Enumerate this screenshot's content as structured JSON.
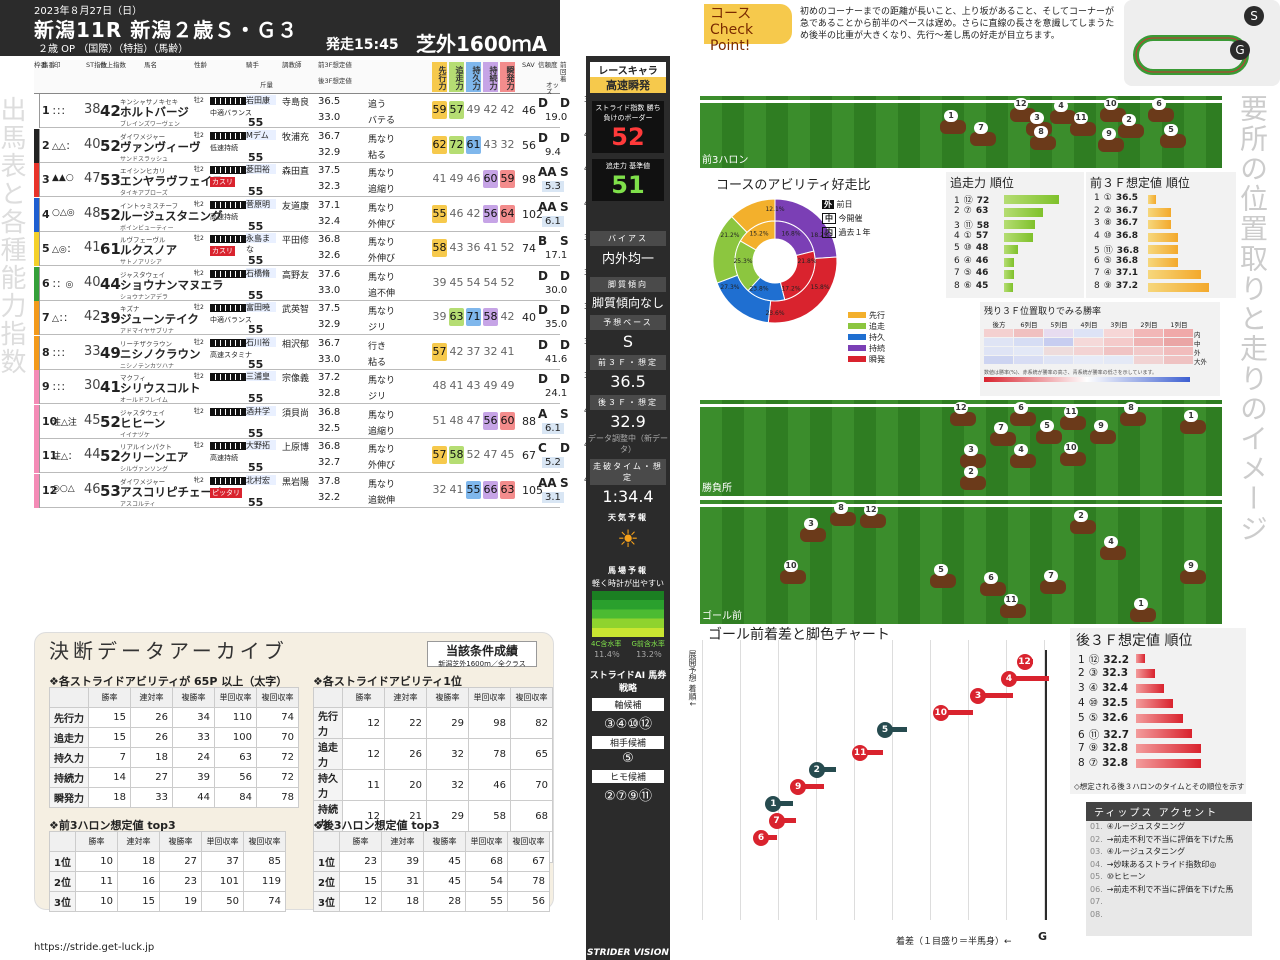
{
  "header": {
    "date": "2023年８月27日（日）",
    "race": "新潟11R  新潟２歳Ｓ・Ｇ３",
    "conditions": "２歳 OP （国際）（特指）（馬齢）",
    "start": "発走15:45",
    "distance": "芝外1600ｍA"
  },
  "course_panel": {
    "title": "コース",
    "subtitle": "Check Point!",
    "text": "初めのコーナーまでの距離が長いこと、上り坂があること、そしてコーナーが急であることから前半のペースは遅め。さらに直線の長さを意識してしまうため後半の比重が大きくなり、先行～差し馬の好走が目立ちます。"
  },
  "side_left": "出馬表と各種能力指数",
  "side_right": "要所の位置取りと走りのイメージ",
  "col_headers": [
    "枠番",
    "馬番",
    "印",
    "ST指数",
    "仕上指数",
    "馬名",
    "性齢",
    "騎手",
    "斤量",
    "調教師",
    "前3F想定値",
    "後3F想定値",
    "先行力",
    "追走力",
    "持久力",
    "持続力",
    "瞬発力",
    "SAV",
    "信頼度",
    "前回着",
    "オッズ"
  ],
  "ability_headers": [
    "先行力",
    "追走力",
    "持久力",
    "持続力",
    "瞬発力"
  ],
  "horses": [
    {
      "frame": "1",
      "num": "1",
      "mark": "：：：",
      "st": "38",
      "sh": "42",
      "sire": "キンシャサノキセキ",
      "name": "ホルトバージ",
      "dam": "ブレインズワーヴェン",
      "sex": "牡2",
      "tag": "中適バランス",
      "wt": "55",
      "jockey": "岩田康",
      "trainer": "寺島良",
      "f3": "36.5",
      "l3": "33.0",
      "c1": "追う",
      "c2": "バテる",
      "ab": [
        "59",
        "57",
        "49",
        "42",
        "42"
      ],
      "sav": "46",
      "g1": "D",
      "g2": "D",
      "odds": "19.0",
      "ax": "38"
    },
    {
      "frame": "2",
      "num": "2",
      "mark": "△△：",
      "st": "40",
      "sh": "52",
      "sire": "ダイワメジャー",
      "name": "ヴァンヴィーヴ",
      "dam": "サンドスラッシュ",
      "sex": "牡2",
      "tag": "低速持続",
      "wt": "55",
      "jockey": "Mデム",
      "trainer": "牧浦充",
      "f3": "36.7",
      "l3": "32.9",
      "c1": "馬なり",
      "c2": "粘る",
      "ab": [
        "62",
        "72",
        "61",
        "43",
        "32"
      ],
      "sav": "56",
      "g1": "D",
      "g2": "D",
      "odds": "9.4",
      "ax": "40"
    },
    {
      "frame": "3",
      "num": "3",
      "mark": "▲▲○",
      "st": "47",
      "sh": "53",
      "sire": "エイシンヒカリ",
      "name": "エンヤラヴフェイス",
      "dam": "タイキアプローズ",
      "sex": "牡2",
      "tag": "カスリ",
      "wt": "55",
      "jockey": "菱田裕",
      "trainer": "森田直",
      "f3": "37.5",
      "l3": "32.3",
      "c1": "馬なり",
      "c2": "追縮り",
      "ab": [
        "41",
        "49",
        "46",
        "60",
        "59"
      ],
      "sav": "98",
      "g1": "AA",
      "g2": "S",
      "odds": "5.3",
      "ax": "43"
    },
    {
      "frame": "4",
      "num": "4",
      "mark": "○△◎",
      "st": "48",
      "sh": "52",
      "sire": "イントゥミスチーフ",
      "name": "ルージュスタニング",
      "dam": "ボインビューティー",
      "sex": "牝2",
      "tag": "高速持続",
      "wt": "55",
      "jockey": "菅原明",
      "trainer": "友道康",
      "f3": "37.1",
      "l3": "32.4",
      "c1": "馬なり",
      "c2": "外伸び",
      "ab": [
        "55",
        "46",
        "42",
        "56",
        "64"
      ],
      "sav": "102",
      "g1": "AA",
      "g2": "S",
      "odds": "6.1",
      "ax": "44"
    },
    {
      "frame": "5",
      "num": "5",
      "mark": "△◎：",
      "st": "41",
      "sh": "61",
      "sire": "ルヴフェーヴル",
      "name": "ルクスノア",
      "dam": "サトノアリシア",
      "sex": "牡2",
      "tag": "カスリ",
      "wt": "55",
      "jockey": "永島まな",
      "trainer": "平田修",
      "f3": "36.8",
      "l3": "32.6",
      "c1": "馬なり",
      "c2": "外伸び",
      "ab": [
        "58",
        "43",
        "36",
        "41",
        "52"
      ],
      "sav": "74",
      "g1": "B",
      "g2": "S",
      "odds": "17.1",
      "ax": "37"
    },
    {
      "frame": "6",
      "num": "6",
      "mark": "：：◎",
      "st": "40",
      "sh": "44",
      "sire": "ジャスタウェイ",
      "name": "ショウナンマヌエラ",
      "dam": "ショウナンアデラ",
      "sex": "牝2",
      "tag": "",
      "wt": "55",
      "jockey": "石橋脩",
      "trainer": "高野友",
      "f3": "37.6",
      "l3": "33.0",
      "c1": "馬なり",
      "c2": "追不伸",
      "ab": [
        "39",
        "45",
        "54",
        "54",
        "52"
      ],
      "sav": "",
      "g1": "D",
      "g2": "D",
      "odds": "30.0",
      "ax": "36"
    },
    {
      "frame": "7",
      "num": "7",
      "mark": "△：：",
      "st": "42",
      "sh": "39",
      "sire": "キズナ",
      "name": "ジューンテイク",
      "dam": "アドマイヤサブリナ",
      "sex": "牡2",
      "tag": "中適バランス",
      "wt": "55",
      "jockey": "富田暁",
      "trainer": "武英智",
      "f3": "37.5",
      "l3": "32.9",
      "c1": "馬なり",
      "c2": "ジリ",
      "ab": [
        "39",
        "63",
        "71",
        "58",
        "42"
      ],
      "sav": "40",
      "g1": "D",
      "g2": "D",
      "odds": "35.0",
      "ax": "37"
    },
    {
      "frame": "7",
      "num": "8",
      "mark": "：：：",
      "st": "33",
      "sh": "49",
      "sire": "リーチザクラウン",
      "name": "ニシノクラウン",
      "dam": "ニシノテンカツハナ",
      "sex": "牡2",
      "tag": "高速スタミナ",
      "wt": "55",
      "jockey": "石川裕",
      "trainer": "相沢郁",
      "f3": "36.7",
      "l3": "33.0",
      "c1": "行き",
      "c2": "粘る",
      "ab": [
        "57",
        "42",
        "37",
        "32",
        "41"
      ],
      "sav": "",
      "g1": "D",
      "g2": "D",
      "odds": "41.6",
      "ax": "35"
    },
    {
      "frame": "8",
      "num": "9",
      "mark": "：：：",
      "st": "30",
      "sh": "41",
      "sire": "マクフィ",
      "name": "シリウスコルト",
      "dam": "オールドフレイム",
      "sex": "牡2",
      "tag": "",
      "wt": "55",
      "jockey": "三浦皇",
      "trainer": "宗像義",
      "f3": "37.2",
      "l3": "32.8",
      "c1": "馬なり",
      "c2": "ジリ",
      "ab": [
        "48",
        "41",
        "43",
        "49",
        "49"
      ],
      "sav": "",
      "g1": "D",
      "g2": "D",
      "odds": "24.1",
      "ax": "39"
    },
    {
      "frame": "8",
      "num": "10",
      "mark": "注△注",
      "st": "45",
      "sh": "52",
      "sire": "ジャスタウェイ",
      "name": "ヒヒーン",
      "dam": "イイナヅケ",
      "sex": "牡2",
      "tag": "",
      "wt": "55",
      "jockey": "酒井学",
      "trainer": "須貝尚",
      "f3": "36.8",
      "l3": "32.5",
      "c1": "馬なり",
      "c2": "追縮り",
      "ab": [
        "51",
        "48",
        "47",
        "56",
        "60"
      ],
      "sav": "88",
      "g1": "A",
      "g2": "S",
      "odds": "6.1",
      "ax": "41"
    },
    {
      "frame": "8",
      "num": "11",
      "mark": "注△：",
      "st": "44",
      "sh": "52",
      "sire": "リアルインパクト",
      "name": "クリーンエア",
      "dam": "シルヴァンソング",
      "sex": "牡2",
      "tag": "高速持続",
      "wt": "55",
      "jockey": "大野拓",
      "trainer": "上原博",
      "f3": "36.8",
      "l3": "32.7",
      "c1": "馬なり",
      "c2": "外伸び",
      "ab": [
        "57",
        "58",
        "52",
        "47",
        "45"
      ],
      "sav": "67",
      "g1": "C",
      "g2": "D",
      "odds": "5.2",
      "ax": "40"
    },
    {
      "frame": "8",
      "num": "12",
      "mark": "◎○△",
      "st": "46",
      "sh": "53",
      "sire": "ダイワメジャー",
      "name": "アスコリピチェーノ",
      "dam": "アスコルティ",
      "sex": "牝2",
      "tag": "ピッタリ",
      "wt": "55",
      "jockey": "北村宏",
      "trainer": "黒岩陽",
      "f3": "37.8",
      "l3": "32.2",
      "c1": "馬なり",
      "c2": "追鋭伸",
      "ab": [
        "32",
        "41",
        "55",
        "66",
        "63"
      ],
      "sav": "105",
      "g1": "AA",
      "g2": "S",
      "odds": "3.1",
      "ax": "42"
    }
  ],
  "center": {
    "race_chara_label": "レースキャラ",
    "race_chara": "高速瞬発",
    "border_label": "ストライド指数 勝ち負けのボーダー",
    "border": "52",
    "chase_label": "追走力 基準値",
    "chase": "51",
    "bias_label": "バイアス",
    "bias": "内外均一",
    "leg_label": "脚質傾向",
    "leg": "脚質傾向なし",
    "pace_label": "予想ペース",
    "pace": "S",
    "f3f_label": "前３Ｆ・想定",
    "f3f": "36.5",
    "l3f_label": "後３Ｆ・想定",
    "l3f": "32.9",
    "adj": "データ調整中（新データ）",
    "time_label": "走破タイム・想定",
    "time": "1:34.4",
    "weather_label": "天気予報",
    "track_label": "馬場予報",
    "track": "軽く時計が出やすい",
    "moist_a": "4C含水率",
    "moist_a_v": "11.4％",
    "moist_b": "G前含水率",
    "moist_b_v": "13.2％",
    "ai_label": "ストライドAI 馬券戦略",
    "axis_label": "軸候補",
    "axis": "③④⑩⑫",
    "partner_label": "相手候補",
    "partner": "⑤",
    "hole_label": "ヒモ候補",
    "hole": "②⑦⑨⑪",
    "tenkai": "展開予想 着順↓"
  },
  "archive": {
    "title": "決断データアーカイブ",
    "sub": "当該条件成績",
    "sub2": "新潟芝外1600m／全クラス",
    "t1_title": "❖各ストライドアビリティが 65P 以上（太字）",
    "t2_title": "❖各ストライドアビリティ1位",
    "t3_title": "❖前3ハロン想定値 top3",
    "t4_title": "❖後3ハロン想定値 top3",
    "cols": [
      "勝率",
      "連対率",
      "複勝率",
      "単回収率",
      "複回収率"
    ],
    "t1": [
      [
        "先行力",
        "15",
        "26",
        "34",
        "110",
        "74"
      ],
      [
        "追走力",
        "15",
        "26",
        "33",
        "100",
        "70"
      ],
      [
        "持久力",
        "7",
        "18",
        "24",
        "63",
        "72"
      ],
      [
        "持続力",
        "14",
        "27",
        "39",
        "56",
        "72"
      ],
      [
        "瞬発力",
        "18",
        "33",
        "44",
        "84",
        "78"
      ]
    ],
    "t2": [
      [
        "先行力",
        "12",
        "22",
        "29",
        "98",
        "82"
      ],
      [
        "追走力",
        "12",
        "26",
        "32",
        "78",
        "65"
      ],
      [
        "持久力",
        "11",
        "20",
        "32",
        "46",
        "70"
      ],
      [
        "持続力",
        "12",
        "21",
        "29",
        "58",
        "68"
      ],
      [
        "瞬発力",
        "15",
        "22",
        "32",
        "68",
        "59"
      ]
    ],
    "t3": [
      [
        "1位",
        "10",
        "18",
        "27",
        "37",
        "85"
      ],
      [
        "2位",
        "11",
        "16",
        "23",
        "101",
        "119"
      ],
      [
        "3位",
        "10",
        "15",
        "19",
        "50",
        "74"
      ]
    ],
    "t4": [
      [
        "1位",
        "23",
        "39",
        "45",
        "68",
        "67"
      ],
      [
        "2位",
        "15",
        "31",
        "45",
        "54",
        "78"
      ],
      [
        "3位",
        "12",
        "18",
        "28",
        "55",
        "56"
      ]
    ]
  },
  "footer": "https://stride.get-luck.jp",
  "panels": {
    "front3": "前3ハロン",
    "katsuzoku": "勝負所",
    "goal": "ゴール前"
  },
  "donut": {
    "title": "コースのアビリティ好走比",
    "legend_labels": [
      "前日",
      "今開催",
      "過去１年"
    ],
    "abilities": [
      "先行",
      "追走",
      "持久",
      "持続",
      "瞬発"
    ],
    "colors": [
      "#f3b02c",
      "#8cc63f",
      "#1f6fd1",
      "#7b3fb5",
      "#d9232e"
    ],
    "labels": [
      "12.1%",
      "16.8%",
      "18.2%",
      "21.8%",
      "15.8%",
      "17.2%",
      "23.6%",
      "23.8%",
      "27.3%",
      "25.3%",
      "21.2%",
      "15.2%"
    ]
  },
  "chase_rank": {
    "title": "追走力 順位",
    "rows": [
      [
        "1",
        "⑫",
        "72"
      ],
      [
        "2",
        "⑦",
        "63"
      ],
      [
        "3",
        "⑪",
        "58"
      ],
      [
        "4",
        "①",
        "57"
      ],
      [
        "5",
        "⑩",
        "48"
      ],
      [
        "6",
        "④",
        "46"
      ],
      [
        "7",
        "⑤",
        "46"
      ],
      [
        "8",
        "⑥",
        "45"
      ]
    ]
  },
  "f3_rank": {
    "title": "前３Ｆ想定値 順位",
    "rows": [
      [
        "1",
        "①",
        "36.5"
      ],
      [
        "2",
        "②",
        "36.7"
      ],
      [
        "3",
        "⑧",
        "36.7"
      ],
      [
        "4",
        "⑩",
        "36.8"
      ],
      [
        "5",
        "⑪",
        "36.8"
      ],
      [
        "6",
        "⑤",
        "36.8"
      ],
      [
        "7",
        "④",
        "37.1"
      ],
      [
        "8",
        "⑨",
        "37.2"
      ]
    ]
  },
  "l3_rank": {
    "title": "後３Ｆ想定値 順位",
    "rows": [
      [
        "1",
        "⑫",
        "32.2"
      ],
      [
        "2",
        "③",
        "32.3"
      ],
      [
        "3",
        "④",
        "32.4"
      ],
      [
        "4",
        "⑩",
        "32.5"
      ],
      [
        "5",
        "⑤",
        "32.6"
      ],
      [
        "6",
        "⑪",
        "32.7"
      ],
      [
        "7",
        "⑨",
        "32.8"
      ],
      [
        "8",
        "⑦",
        "32.8"
      ]
    ],
    "note": "◇想定される後３ハロンのタイムとその順位を示す"
  },
  "winrate": {
    "title": "残り３Ｆ位置取りでみる勝率",
    "cols": [
      "後方",
      "6列目",
      "5列目",
      "4列目",
      "3列目",
      "2列目",
      "1列目"
    ],
    "rows": [
      "内",
      "中",
      "外",
      "大外"
    ],
    "note": "数値は勝率(%)、赤系統が勝率の高さ、青系統が勝率の低さを示しています。"
  },
  "goal_chart": {
    "title": "ゴール前着差と脚色チャート",
    "axis": "着差（１目盛り＝半馬身）←",
    "g": "G",
    "horses": [
      {
        "n": "12",
        "c": "#d9232e",
        "pos": 0.95,
        "len": 0.0
      },
      {
        "n": "4",
        "c": "#d9232e",
        "pos": 0.9,
        "len": 0.25
      },
      {
        "n": "3",
        "c": "#d9232e",
        "pos": 0.8,
        "len": 0.22
      },
      {
        "n": "10",
        "c": "#d9232e",
        "pos": 0.68,
        "len": 0.2
      },
      {
        "n": "5",
        "c": "#264b4f",
        "pos": 0.5,
        "len": 0.14
      },
      {
        "n": "11",
        "c": "#d9232e",
        "pos": 0.42,
        "len": 0.14
      },
      {
        "n": "2",
        "c": "#264b4f",
        "pos": 0.28,
        "len": 0.12
      },
      {
        "n": "9",
        "c": "#d9232e",
        "pos": 0.22,
        "len": 0.16
      },
      {
        "n": "1",
        "c": "#264b4f",
        "pos": 0.14,
        "len": 0.12
      },
      {
        "n": "7",
        "c": "#d9232e",
        "pos": 0.15,
        "len": 0.12
      },
      {
        "n": "6",
        "c": "#d9232e",
        "pos": 0.1,
        "len": 0.1
      }
    ]
  },
  "tips": {
    "title": "ティップス アクセント",
    "items": [
      "④ルージュスタニング",
      "→前走不利で不当に評価を下げた馬",
      "④ルージュスタニング",
      "→妙味あるストライド指数印◎",
      "⑩ヒヒーン",
      "→前走不利で不当に評価を下げた馬",
      "",
      ""
    ]
  },
  "brand": "STRIDER VISION"
}
